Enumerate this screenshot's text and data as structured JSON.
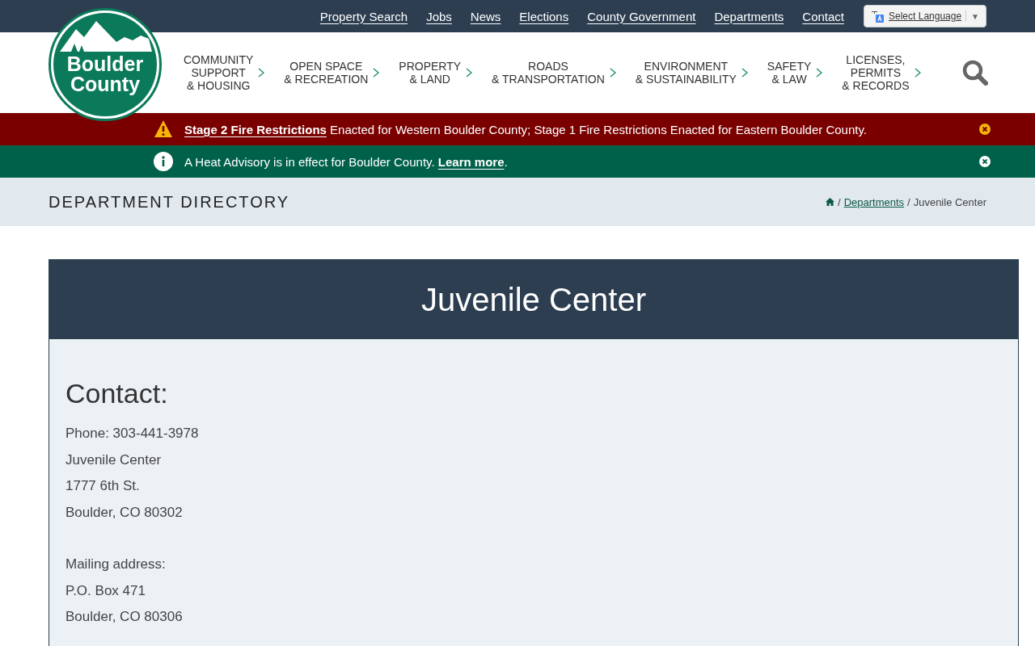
{
  "utility_links": [
    "Property Search",
    "Jobs",
    "News",
    "Elections",
    "County Government",
    "Departments",
    "Contact"
  ],
  "language_select": {
    "label": "Select Language",
    "caret": "▼"
  },
  "logo": {
    "lines": [
      "Boulder",
      "County"
    ]
  },
  "main_nav": [
    {
      "lines": [
        "COMMUNITY",
        "SUPPORT",
        "& HOUSING"
      ]
    },
    {
      "lines": [
        "OPEN SPACE",
        "& RECREATION"
      ]
    },
    {
      "lines": [
        "PROPERTY",
        "& LAND"
      ]
    },
    {
      "lines": [
        "ROADS",
        "& TRANSPORTATION"
      ]
    },
    {
      "lines": [
        "ENVIRONMENT",
        "& SUSTAINABILITY"
      ]
    },
    {
      "lines": [
        "SAFETY",
        "& LAW"
      ]
    },
    {
      "lines": [
        "LICENSES,",
        "PERMITS",
        "& RECORDS"
      ]
    }
  ],
  "alerts": [
    {
      "kind": "warning",
      "parts": [
        {
          "kind": "link",
          "text": "Stage 2 Fire Restrictions"
        },
        {
          "kind": "text",
          "text": " Enacted for Western Boulder County; Stage 1 Fire Restrictions Enacted for Eastern Boulder County."
        }
      ]
    },
    {
      "kind": "info",
      "parts": [
        {
          "kind": "text",
          "text": "A Heat Advisory is in effect for Boulder County. "
        },
        {
          "kind": "link",
          "text": "Learn more"
        },
        {
          "kind": "text",
          "text": "."
        }
      ]
    }
  ],
  "page_header": {
    "title": "DEPARTMENT DIRECTORY",
    "breadcrumb": [
      {
        "kind": "separator",
        "text": "/"
      },
      {
        "kind": "link",
        "text": "Departments"
      },
      {
        "kind": "separator",
        "text": "/"
      },
      {
        "kind": "current",
        "text": "Juvenile Center"
      }
    ]
  },
  "card": {
    "title": "Juvenile Center",
    "heading": "Contact:",
    "groups": [
      [
        "Phone: 303-441-3978",
        "Juvenile Center",
        "1777 6th St.",
        "Boulder, CO 80302"
      ],
      [
        "Mailing address:",
        "P.O. Box 471",
        "Boulder, CO 80306"
      ]
    ]
  }
}
